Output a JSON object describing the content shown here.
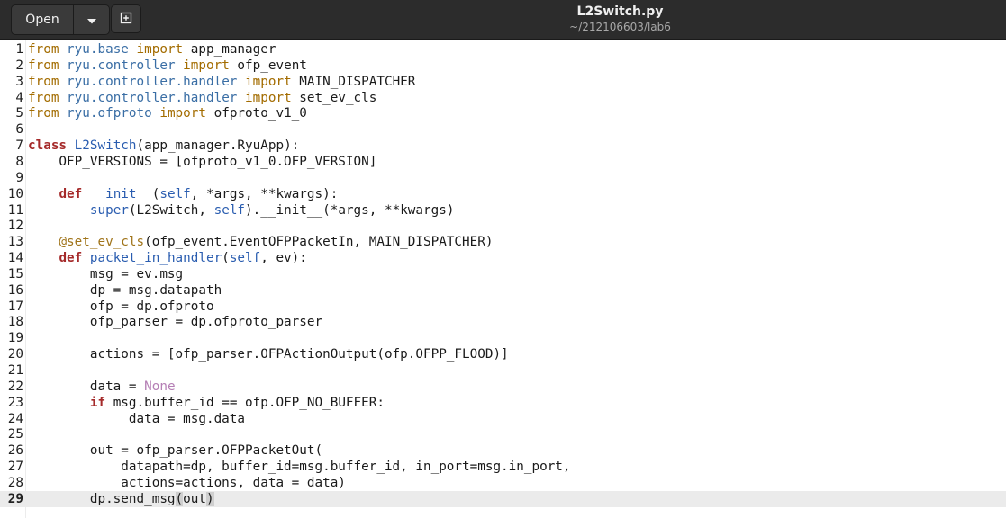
{
  "header": {
    "open_label": "Open",
    "title": "L2Switch.py",
    "subtitle": "~/212106603/lab6",
    "icons": {
      "menu": "chevron-down-icon",
      "new": "new-document-icon"
    }
  },
  "colors": {
    "keyword": "#a52a2a",
    "module": "#3a6ea5",
    "import_keyword": "#a36c00",
    "function": "#2a5db0",
    "decorator": "#a0741a",
    "constant": "#b57fb5",
    "header_bg": "#2c2c2c",
    "current_line": "#ebebeb"
  },
  "editor": {
    "current_line": 29,
    "lines": [
      {
        "n": "1",
        "tokens": [
          [
            "from",
            "imp"
          ],
          [
            " ryu.base ",
            "mod"
          ],
          [
            "import",
            "imp"
          ],
          [
            " app_manager",
            ""
          ]
        ]
      },
      {
        "n": "2",
        "tokens": [
          [
            "from",
            "imp"
          ],
          [
            " ryu.controller ",
            "mod"
          ],
          [
            "import",
            "imp"
          ],
          [
            " ofp_event",
            ""
          ]
        ]
      },
      {
        "n": "3",
        "tokens": [
          [
            "from",
            "imp"
          ],
          [
            " ryu.controller.handler ",
            "mod"
          ],
          [
            "import",
            "imp"
          ],
          [
            " MAIN_DISPATCHER",
            ""
          ]
        ]
      },
      {
        "n": "4",
        "tokens": [
          [
            "from",
            "imp"
          ],
          [
            " ryu.controller.handler ",
            "mod"
          ],
          [
            "import",
            "imp"
          ],
          [
            " set_ev_cls",
            ""
          ]
        ]
      },
      {
        "n": "5",
        "tokens": [
          [
            "from",
            "imp"
          ],
          [
            " ryu.ofproto ",
            "mod"
          ],
          [
            "import",
            "imp"
          ],
          [
            " ofproto_v1_0",
            ""
          ]
        ]
      },
      {
        "n": "6",
        "tokens": []
      },
      {
        "n": "7",
        "tokens": [
          [
            "class",
            "kw"
          ],
          [
            " ",
            ""
          ],
          [
            "L2Switch",
            "fn"
          ],
          [
            "(app_manager.RyuApp):",
            ""
          ]
        ]
      },
      {
        "n": "8",
        "tokens": [
          [
            "    OFP_VERSIONS = [ofproto_v1_0.OFP_VERSION]",
            ""
          ]
        ]
      },
      {
        "n": "9",
        "tokens": []
      },
      {
        "n": "10",
        "tokens": [
          [
            "    ",
            ""
          ],
          [
            "def",
            "kw"
          ],
          [
            " ",
            ""
          ],
          [
            "__init__",
            "fn"
          ],
          [
            "(",
            ""
          ],
          [
            "self",
            "bi"
          ],
          [
            ", *args, **kwargs):",
            ""
          ]
        ]
      },
      {
        "n": "11",
        "tokens": [
          [
            "        ",
            ""
          ],
          [
            "super",
            "bi"
          ],
          [
            "(L2Switch, ",
            ""
          ],
          [
            "self",
            "bi"
          ],
          [
            ").__init__(*args, **kwargs)",
            ""
          ]
        ]
      },
      {
        "n": "12",
        "tokens": []
      },
      {
        "n": "13",
        "tokens": [
          [
            "    ",
            ""
          ],
          [
            "@set_ev_cls",
            "deco"
          ],
          [
            "(ofp_event.EventOFPPacketIn, MAIN_DISPATCHER)",
            ""
          ]
        ]
      },
      {
        "n": "14",
        "tokens": [
          [
            "    ",
            ""
          ],
          [
            "def",
            "kw"
          ],
          [
            " ",
            ""
          ],
          [
            "packet_in_handler",
            "fn"
          ],
          [
            "(",
            ""
          ],
          [
            "self",
            "bi"
          ],
          [
            ", ev):",
            ""
          ]
        ]
      },
      {
        "n": "15",
        "tokens": [
          [
            "        msg = ev.msg",
            ""
          ]
        ]
      },
      {
        "n": "16",
        "tokens": [
          [
            "        dp = msg.datapath",
            ""
          ]
        ]
      },
      {
        "n": "17",
        "tokens": [
          [
            "        ofp = dp.ofproto",
            ""
          ]
        ]
      },
      {
        "n": "18",
        "tokens": [
          [
            "        ofp_parser = dp.ofproto_parser",
            ""
          ]
        ]
      },
      {
        "n": "19",
        "tokens": []
      },
      {
        "n": "20",
        "tokens": [
          [
            "        actions = [ofp_parser.OFPActionOutput(ofp.OFPP_FLOOD)]",
            ""
          ]
        ]
      },
      {
        "n": "21",
        "tokens": []
      },
      {
        "n": "22",
        "tokens": [
          [
            "        data = ",
            ""
          ],
          [
            "None",
            "const"
          ]
        ]
      },
      {
        "n": "23",
        "tokens": [
          [
            "        ",
            ""
          ],
          [
            "if",
            "kw"
          ],
          [
            " msg.buffer_id == ofp.OFP_NO_BUFFER:",
            ""
          ]
        ]
      },
      {
        "n": "24",
        "tokens": [
          [
            "             data = msg.data",
            ""
          ]
        ]
      },
      {
        "n": "25",
        "tokens": []
      },
      {
        "n": "26",
        "tokens": [
          [
            "        out = ofp_parser.OFPPacketOut(",
            ""
          ]
        ]
      },
      {
        "n": "27",
        "tokens": [
          [
            "            datapath=dp, buffer_id=msg.buffer_id, in_port=msg.in_port,",
            ""
          ]
        ]
      },
      {
        "n": "28",
        "tokens": [
          [
            "            actions=actions, data = data)",
            ""
          ]
        ]
      },
      {
        "n": "29",
        "tokens": [
          [
            "        dp.send_msg",
            ""
          ],
          [
            "(",
            "br"
          ],
          [
            "out",
            ""
          ],
          [
            ")",
            "br"
          ]
        ]
      }
    ]
  }
}
